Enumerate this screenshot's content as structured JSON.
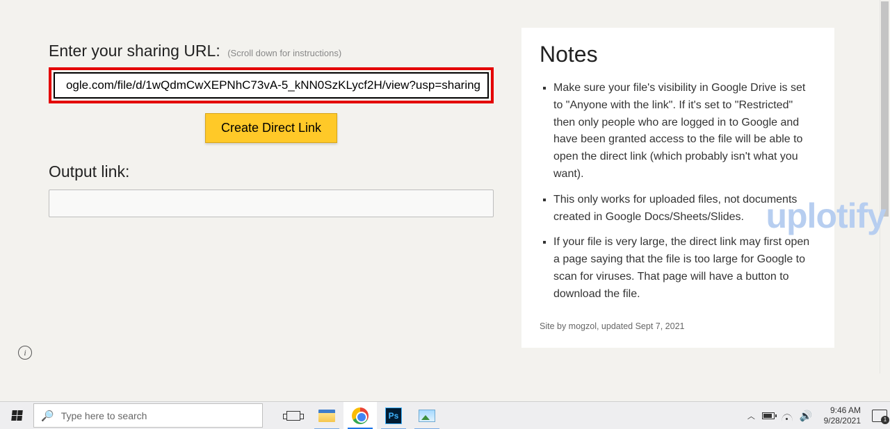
{
  "left": {
    "label": "Enter your sharing URL:",
    "hint": "(Scroll down for instructions)",
    "url_value": "ogle.com/file/d/1wQdmCwXEPNhC73vA-5_kNN0SzKLycf2H/view?usp=sharing",
    "create_button": "Create Direct Link",
    "output_label": "Output link:",
    "output_value": ""
  },
  "notes": {
    "title": "Notes",
    "items": [
      "Make sure your file's visibility in Google Drive is set to \"Anyone with the link\". If it's set to \"Restricted\" then only people who are logged in to Google and have been granted access to the file will be able to open the direct link (which probably isn't what you want).",
      "This only works for uploaded files, not documents created in Google Docs/Sheets/Slides.",
      "If your file is very large, the direct link may first open a page saying that the file is too large for Google to scan for viruses. That page will have a button to download the file."
    ],
    "credit": "Site by mogzol, updated Sept 7, 2021"
  },
  "watermark": "uplotify",
  "info_badge": "i",
  "taskbar": {
    "search_placeholder": "Type here to search",
    "ps_label": "Ps",
    "clock_time": "9:46 AM",
    "clock_date": "9/28/2021",
    "action_count": "1"
  }
}
